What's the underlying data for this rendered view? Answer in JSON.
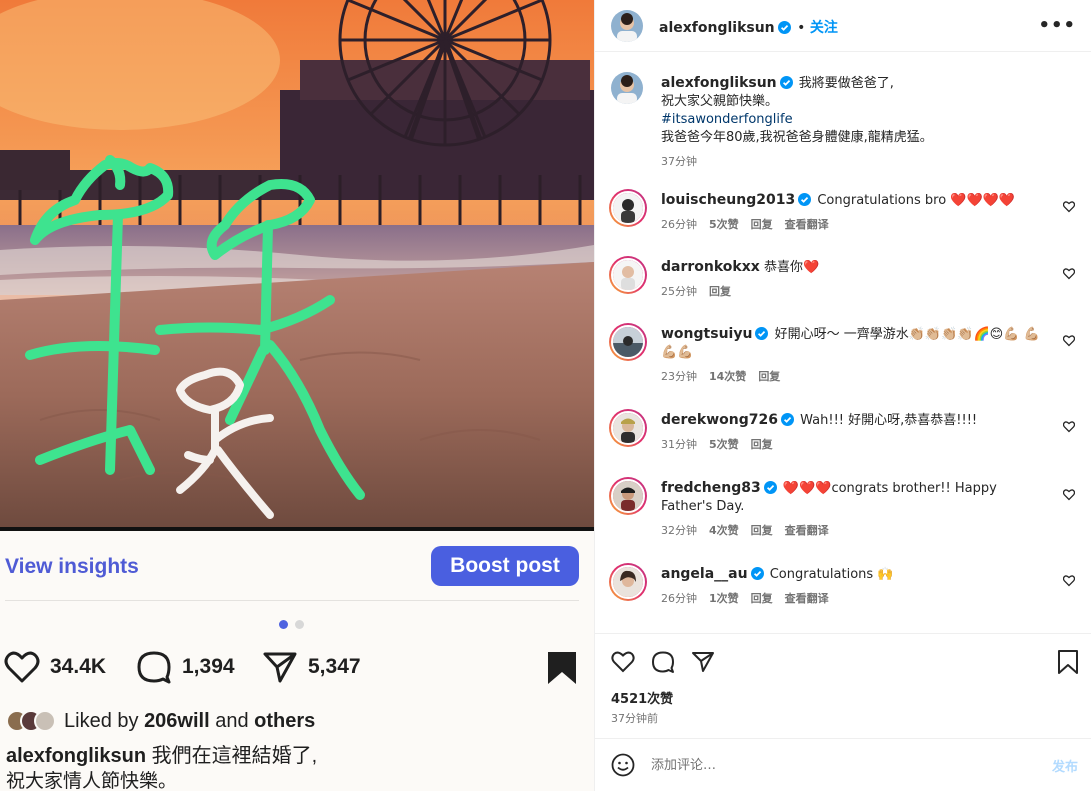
{
  "inner_post": {
    "insights_label": "View insights",
    "boost_label": "Boost post",
    "likes": "34.4K",
    "comments": "1,394",
    "shares": "5,347",
    "liked_by_prefix": "Liked by",
    "liked_by_user": "206will",
    "liked_by_suffix": "and",
    "liked_by_others": "others",
    "caption_user": "alexfongliksun",
    "caption_line1": "我們在這裡結婚了,",
    "caption_line2": "祝大家情人節快樂。",
    "carousel_active": 1,
    "carousel_total": 2
  },
  "header": {
    "username": "alexfongliksun",
    "separator": "•",
    "follow_label": "关注",
    "more_label": "•••"
  },
  "caption": {
    "username": "alexfongliksun",
    "line1": "我將要做爸爸了,",
    "line2": "祝大家父親節快樂。",
    "hashtag": "#itsawonderfonglife",
    "line3": "我爸爸今年80歲,我祝爸爸身體健康,龍精虎猛。",
    "time": "37分钟"
  },
  "comments": [
    {
      "username": "louischeung2013",
      "verified": true,
      "text": "Congratulations bro",
      "emoji": "❤️❤️❤️❤️",
      "time": "26分钟",
      "likes": "5次赞",
      "reply": "回复",
      "translate": "查看翻译"
    },
    {
      "username": "darronkokxx",
      "verified": false,
      "text": "恭喜你",
      "emoji": "❤️",
      "time": "25分钟",
      "likes": "",
      "reply": "回复",
      "translate": ""
    },
    {
      "username": "wongtsuiyu",
      "verified": true,
      "text": "好開心呀～ 一齊學游水",
      "emoji": "👏🏼👏🏼👏🏼👏🏼🌈😊💪🏼 💪🏼💪🏼💪🏼",
      "time": "23分钟",
      "likes": "14次赞",
      "reply": "回复",
      "translate": ""
    },
    {
      "username": "derekwong726",
      "verified": true,
      "text": "Wah!!! 好開心呀,恭喜恭喜!!!!",
      "emoji": "",
      "time": "31分钟",
      "likes": "5次赞",
      "reply": "回复",
      "translate": ""
    },
    {
      "username": "fredcheng83",
      "verified": true,
      "text": "congrats brother!! Happy Father's Day.",
      "emoji": "❤️❤️❤️",
      "time": "32分钟",
      "likes": "4次赞",
      "reply": "回复",
      "translate": "查看翻译"
    },
    {
      "username": "angela__au",
      "verified": true,
      "text": "Congratulations",
      "emoji": "🙌",
      "time": "26分钟",
      "likes": "1次赞",
      "reply": "回复",
      "translate": "查看翻译"
    }
  ],
  "footer": {
    "likes_count": "4521次赞",
    "post_time": "37分钟前",
    "comment_placeholder": "添加评论…",
    "post_label": "发布"
  },
  "colors": {
    "accent_blue": "#0095f6",
    "boost_blue": "#4a5fe0",
    "insights_blue": "#4f5bd5",
    "doodle_green": "#3ee38f"
  }
}
